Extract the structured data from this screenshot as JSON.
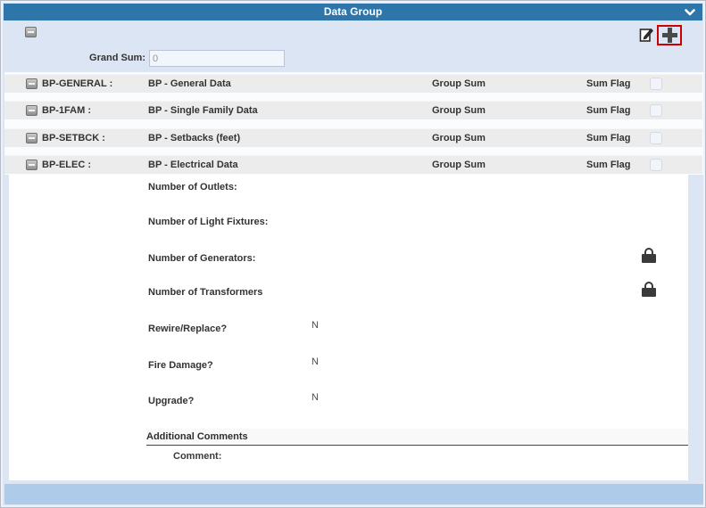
{
  "header": {
    "title": "Data Group"
  },
  "toolbar": {
    "grand_sum_label": "Grand Sum:",
    "grand_sum_value": "0"
  },
  "groups": [
    {
      "code": "BP-GENERAL :",
      "description": "BP - General Data",
      "group_sum_label": "Group Sum",
      "sum_flag_label": "Sum Flag"
    },
    {
      "code": "BP-1FAM :",
      "description": "BP - Single Family Data",
      "group_sum_label": "Group Sum",
      "sum_flag_label": "Sum Flag"
    },
    {
      "code": "BP-SETBCK :",
      "description": "BP - Setbacks (feet)",
      "group_sum_label": "Group Sum",
      "sum_flag_label": "Sum Flag"
    },
    {
      "code": "BP-ELEC :",
      "description": "BP - Electrical Data",
      "group_sum_label": "Group Sum",
      "sum_flag_label": "Sum Flag"
    }
  ],
  "elec_detail": {
    "fields": [
      {
        "label": "Number of Outlets:",
        "value": ""
      },
      {
        "label": "Number of Light Fixtures:",
        "value": ""
      },
      {
        "label": "Number of Generators:",
        "value": ""
      },
      {
        "label": "Number of Transformers",
        "value": ""
      },
      {
        "label": "Rewire/Replace?",
        "value": "N"
      },
      {
        "label": "Fire Damage?",
        "value": "N"
      },
      {
        "label": "Upgrade?",
        "value": "N"
      }
    ],
    "comments_header": "Additional Comments",
    "comment_label": "Comment:"
  },
  "colors": {
    "header_blue": "#2e76aa",
    "panel_blue": "#dce5f3",
    "footer_blue": "#aecbe9",
    "row_gray": "#ececec",
    "highlight_red": "#cc0000"
  }
}
